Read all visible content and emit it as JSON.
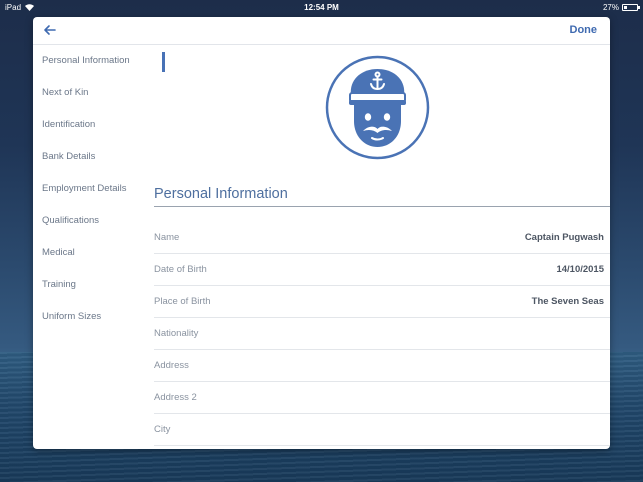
{
  "status_bar": {
    "device": "iPad",
    "time": "12:54 PM",
    "battery_text": "27%",
    "battery_level": 0.27
  },
  "navbar": {
    "back_icon": "arrow-left-icon",
    "done_label": "Done",
    "accent_color": "#3f6ab0"
  },
  "sidebar": {
    "items": [
      {
        "label": "Personal Information",
        "active": true
      },
      {
        "label": "Next of Kin"
      },
      {
        "label": "Identification"
      },
      {
        "label": "Bank Details"
      },
      {
        "label": "Employment Details"
      },
      {
        "label": "Qualifications"
      },
      {
        "label": "Medical"
      },
      {
        "label": "Training"
      },
      {
        "label": "Uniform Sizes"
      }
    ]
  },
  "avatar": {
    "icon": "captain-avatar-icon",
    "color": "#4a73b5"
  },
  "section": {
    "title": "Personal Information",
    "fields": [
      {
        "label": "Name",
        "value": "Captain Pugwash"
      },
      {
        "label": "Date of Birth",
        "value": "14/10/2015"
      },
      {
        "label": "Place of Birth",
        "value": "The Seven Seas"
      },
      {
        "label": "Nationality",
        "value": ""
      },
      {
        "label": "Address",
        "value": ""
      },
      {
        "label": "Address 2",
        "value": ""
      },
      {
        "label": "City",
        "value": ""
      }
    ]
  }
}
